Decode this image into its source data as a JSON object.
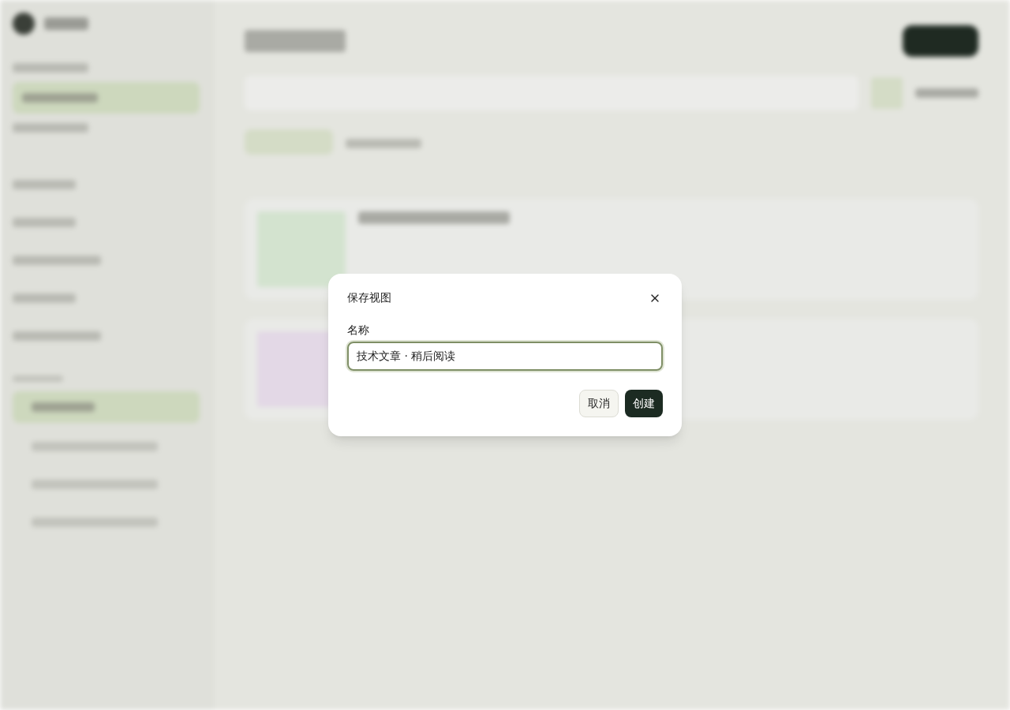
{
  "dialog": {
    "title": "保存视图",
    "field": {
      "label": "名称",
      "value": "技术文章 · 稍后阅读"
    },
    "buttons": [
      {
        "label": "取消",
        "kind": "secondary"
      },
      {
        "label": "创建",
        "kind": "primary"
      }
    ]
  }
}
